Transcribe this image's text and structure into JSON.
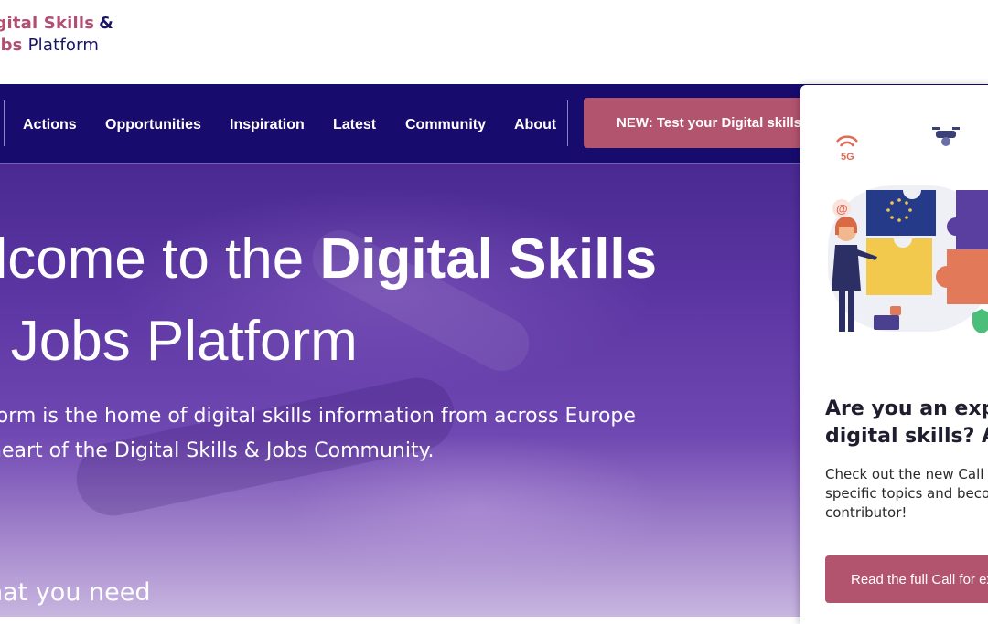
{
  "logo": {
    "line1_text": "igital Skills",
    "line1_amp": "&",
    "line2_bold": "obs",
    "line2_regular": "Platform"
  },
  "nav": {
    "items": [
      {
        "label": "Actions"
      },
      {
        "label": "Opportunities"
      },
      {
        "label": "Inspiration"
      },
      {
        "label": "Latest"
      },
      {
        "label": "Community"
      },
      {
        "label": "About"
      }
    ],
    "cta_label": "NEW: Test your Digital skills"
  },
  "hero": {
    "title_line1_regular": "elcome to the",
    "title_line1_bold": "Digital Skills",
    "title_line2": "d Jobs Platform",
    "subtitle_line1": "form is the home of digital skills information from across Europe",
    "subtitle_line2": "heart of the Digital Skills & Jobs Community.",
    "bottom_text": "hat you need"
  },
  "card": {
    "title_line1": "Are you an expe",
    "title_line2": "digital skills? Ap",
    "text_line1": "Check out the new Call f",
    "text_line2": "specific topics and becor",
    "text_line3": "contributor!",
    "button_label": "Read the full Call for ex",
    "illustration_label": "5G"
  },
  "colors": {
    "brand_pink": "#b3546f",
    "brand_navy": "#170c6e",
    "hero_purple": "#5c36a3"
  }
}
